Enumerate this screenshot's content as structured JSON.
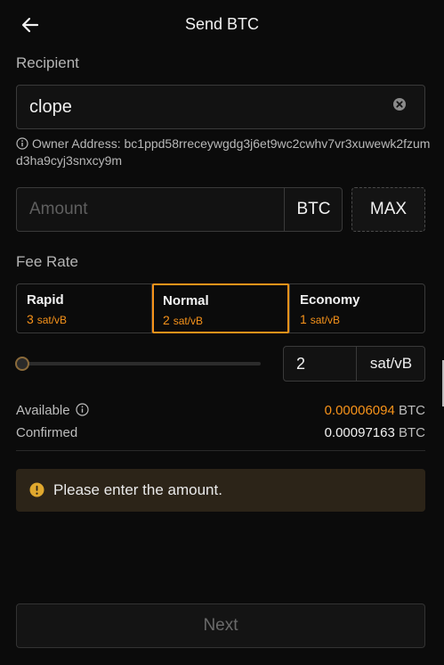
{
  "header": {
    "title": "Send BTC"
  },
  "recipient": {
    "label": "Recipient",
    "value": "clope",
    "owner_prefix": "Owner Address: ",
    "owner_address": "bc1ppd58rreceywgdg3j6et9wc2cwhv7vr3xuwewk2fzumd3ha9cyj3snxcy9m"
  },
  "amount": {
    "placeholder": "Amount",
    "unit": "BTC",
    "max_label": "MAX"
  },
  "fee": {
    "label": "Fee Rate",
    "options": [
      {
        "name": "Rapid",
        "rate": "3",
        "unit": "sat/vB"
      },
      {
        "name": "Normal",
        "rate": "2",
        "unit": "sat/vB",
        "selected": true
      },
      {
        "name": "Economy",
        "rate": "1",
        "unit": "sat/vB"
      }
    ],
    "custom_value": "2",
    "custom_unit": "sat/vB",
    "slider_level": 0
  },
  "balances": {
    "available_label": "Available",
    "available_value": "0.00006094",
    "available_unit": "BTC",
    "confirmed_label": "Confirmed",
    "confirmed_value": "0.00097163",
    "confirmed_unit": "BTC"
  },
  "alert": {
    "message": "Please enter the amount."
  },
  "footer": {
    "next_label": "Next"
  },
  "colors": {
    "accent": "#f7931a",
    "background": "#0b0b0b",
    "alert_bg": "#2c2418"
  }
}
